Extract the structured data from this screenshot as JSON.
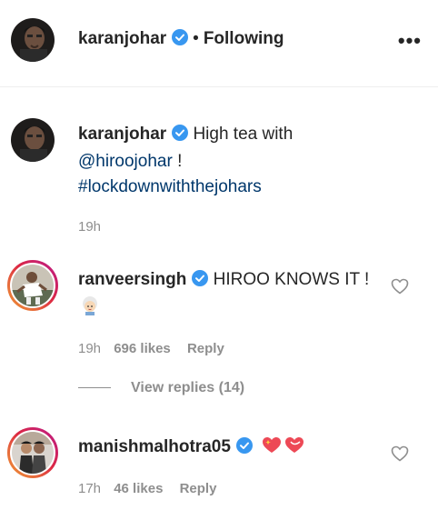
{
  "header": {
    "username": "karanjohar",
    "separator": "•",
    "follow_status": "Following",
    "more_label": "•••"
  },
  "caption": {
    "username": "karanjohar",
    "text_before": "High tea with",
    "mention": "@hiroojohar",
    "text_after": " !",
    "hashtag": "#lockdownwiththejohars",
    "time": "19h"
  },
  "comments": [
    {
      "username": "ranveersingh",
      "text": "HIROO KNOWS IT !",
      "emoji": "old-woman-emoji",
      "time": "19h",
      "likes": "696 likes",
      "reply_label": "Reply"
    },
    {
      "username": "manishmalhotra05",
      "text": "",
      "emoji": "sparkling-heart-emoji",
      "time": "17h",
      "likes": "46 likes",
      "reply_label": "Reply"
    }
  ],
  "view_replies": {
    "label": "View replies (14)"
  },
  "colors": {
    "verified": "#3897f0",
    "link": "#00376b",
    "muted": "#8e8e8e",
    "heart": "#ed4956"
  }
}
